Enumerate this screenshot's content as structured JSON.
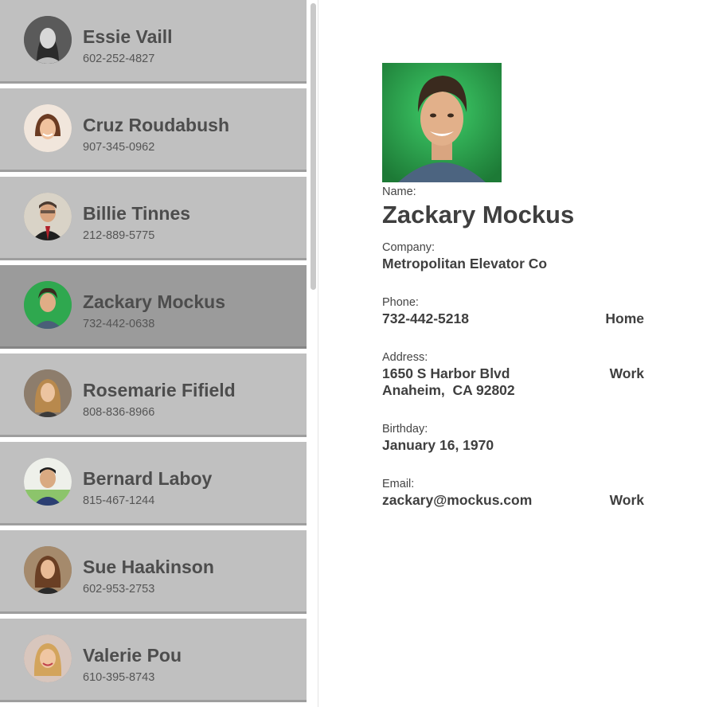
{
  "contacts": [
    {
      "name": "Essie Vaill",
      "phone": "602-252-4827",
      "selected": false
    },
    {
      "name": "Cruz Roudabush",
      "phone": "907-345-0962",
      "selected": false
    },
    {
      "name": "Billie Tinnes",
      "phone": "212-889-5775",
      "selected": false
    },
    {
      "name": "Zackary Mockus",
      "phone": "732-442-0638",
      "selected": true
    },
    {
      "name": "Rosemarie Fifield",
      "phone": "808-836-8966",
      "selected": false
    },
    {
      "name": "Bernard Laboy",
      "phone": "815-467-1244",
      "selected": false
    },
    {
      "name": "Sue Haakinson",
      "phone": "602-953-2753",
      "selected": false
    },
    {
      "name": "Valerie Pou",
      "phone": "610-395-8743",
      "selected": false
    }
  ],
  "detail": {
    "name_label": "Name:",
    "name": "Zackary Mockus",
    "company_label": "Company:",
    "company": "Metropolitan Elevator Co",
    "phone_label": "Phone:",
    "phone": "732-442-5218",
    "phone_type": "Home",
    "address_label": "Address:",
    "address_line1": "1650 S Harbor Blvd",
    "address_line2": "Anaheim,  CA 92802",
    "address_type": "Work",
    "birthday_label": "Birthday:",
    "birthday": "January 16, 1970",
    "email_label": "Email:",
    "email": "zackary@mockus.com",
    "email_type": "Work"
  },
  "colors": {
    "row_bg": "#c0c0c0",
    "row_selected_bg": "#9b9b9b",
    "photo_bg": "#2fa84f"
  }
}
